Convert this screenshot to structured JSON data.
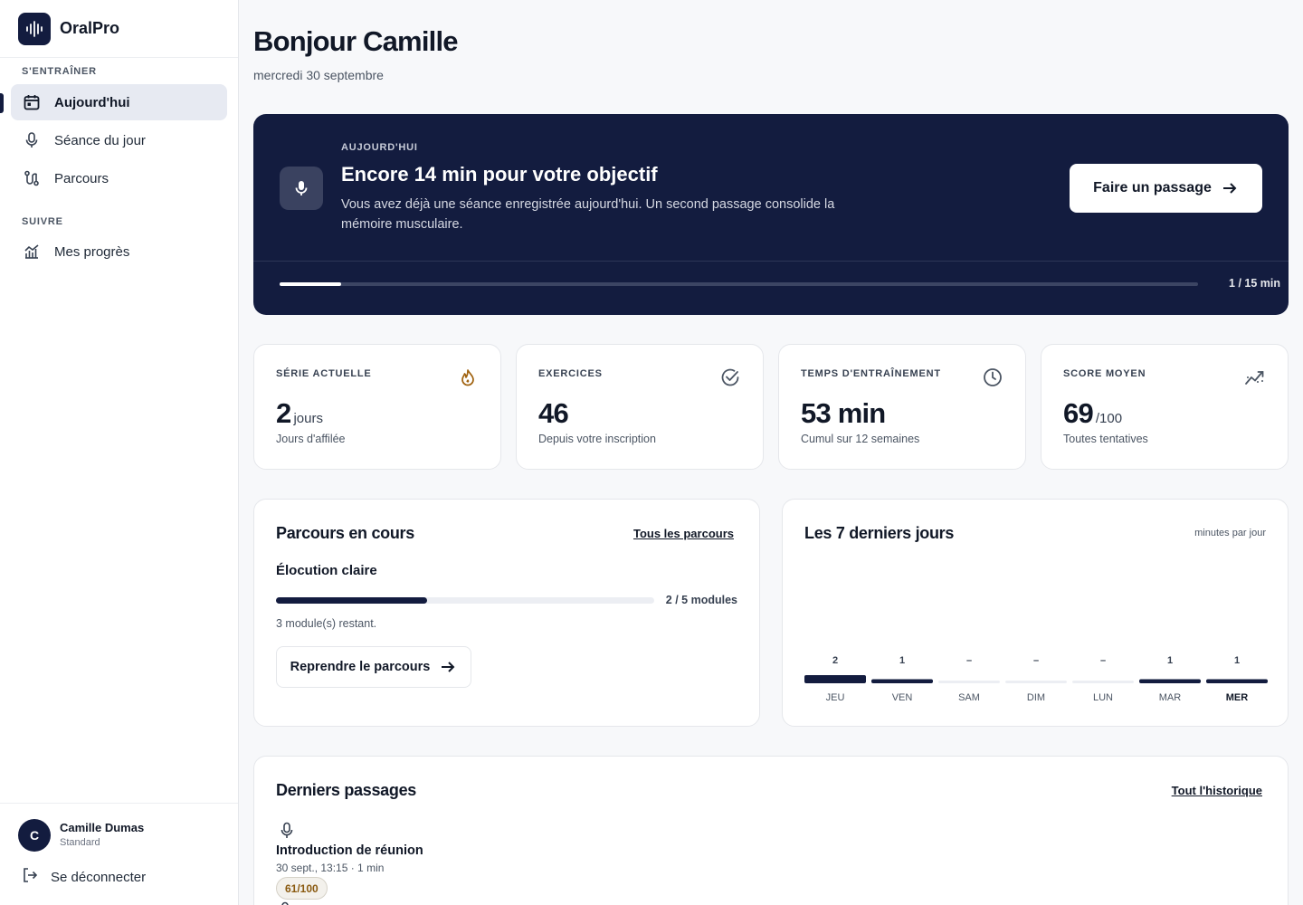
{
  "app": {
    "name": "OralPro"
  },
  "sidebar": {
    "sections": [
      "S'ENTRAÎNER",
      "SUIVRE"
    ],
    "items": [
      {
        "label": "Aujourd'hui",
        "icon": "calendar-icon",
        "active": true
      },
      {
        "label": "Séance du jour",
        "icon": "microphone-icon",
        "active": false
      },
      {
        "label": "Parcours",
        "icon": "route-icon",
        "active": false
      },
      {
        "label": "Mes progrès",
        "icon": "chart-icon",
        "active": false
      }
    ],
    "user": {
      "initial": "C",
      "name": "Camille Dumas",
      "plan": "Standard"
    },
    "logout_label": "Se déconnecter"
  },
  "header": {
    "greeting": "Bonjour Camille",
    "date": "mercredi 30 septembre"
  },
  "hero": {
    "eyebrow": "AUJOURD'HUI",
    "title": "Encore 14 min pour votre objectif",
    "text": "Vous avez déjà une séance enregistrée aujourd'hui. Un second passage consolide la mémoire musculaire.",
    "button_label": "Faire un passage",
    "progress_text": "1 / 15 min",
    "progress_done": 1,
    "progress_goal": 15
  },
  "stats": [
    {
      "label": "SÉRIE ACTUELLE",
      "value": "2",
      "unit": "jours",
      "sub": "Jours d'affilée",
      "icon": "flame-icon",
      "icon_color": "#a0620f"
    },
    {
      "label": "EXERCICES",
      "value": "46",
      "unit": "",
      "sub": "Depuis votre inscription",
      "icon": "check-circle-icon",
      "icon_color": "#4b5563"
    },
    {
      "label": "TEMPS D'ENTRAÎNEMENT",
      "value": "53 min",
      "unit": "",
      "sub": "Cumul sur 12 semaines",
      "icon": "clock-icon",
      "icon_color": "#4b5563"
    },
    {
      "label": "SCORE MOYEN",
      "value": "69",
      "unit": "/100",
      "sub": "Toutes tentatives",
      "icon": "trend-icon",
      "icon_color": "#4b5563"
    }
  ],
  "course": {
    "title": "Parcours en cours",
    "link_label": "Tous les parcours",
    "name": "Élocution claire",
    "modules_text": "2 / 5 modules",
    "modules_done": 2,
    "modules_total": 5,
    "remaining_text": "3 module(s) restant.",
    "button_label": "Reprendre le parcours"
  },
  "chart": {
    "title": "Les 7 derniers jours",
    "unit_label": "minutes par jour"
  },
  "chart_data": {
    "type": "bar",
    "categories": [
      "JEU",
      "VEN",
      "SAM",
      "DIM",
      "LUN",
      "MAR",
      "MER"
    ],
    "values": [
      2,
      1,
      0,
      0,
      0,
      1,
      1
    ],
    "labels": [
      "2",
      "1",
      "–",
      "–",
      "–",
      "1",
      "1"
    ],
    "current_category": "MER",
    "title": "Les 7 derniers jours",
    "ylabel": "minutes par jour",
    "grid": false
  },
  "recent": {
    "title": "Derniers passages",
    "link_label": "Tout l'historique",
    "items": [
      {
        "title": "Introduction de réunion",
        "meta": "30 sept., 13:15 · 1 min",
        "score": "61/100",
        "icon": "microphone-icon"
      }
    ]
  },
  "colors": {
    "navy": "#131c3f",
    "accent_bg": "#e7eaf2",
    "score_badge": "#8a5a10"
  }
}
